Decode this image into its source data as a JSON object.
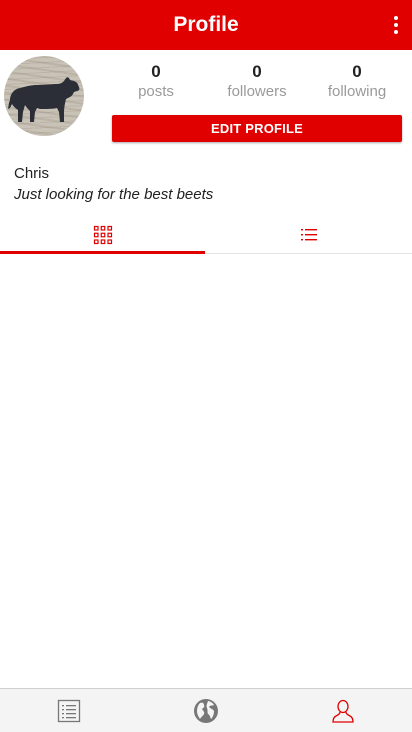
{
  "app_bar": {
    "title": "Profile",
    "color": "#e10000",
    "overflow_icon": "more-vert-icon"
  },
  "profile": {
    "avatar_icon": "cow-silhouette-avatar",
    "stats": [
      {
        "count": "0",
        "label": "posts"
      },
      {
        "count": "0",
        "label": "followers"
      },
      {
        "count": "0",
        "label": "following"
      }
    ],
    "edit_button_label": "EDIT PROFILE",
    "username": "Chris",
    "bio": "Just looking for the best beets"
  },
  "tabs": [
    {
      "icon": "grid-view-icon",
      "selected": true
    },
    {
      "icon": "list-view-icon",
      "selected": false
    }
  ],
  "bottom_nav": [
    {
      "icon": "feed-list-icon",
      "active": false
    },
    {
      "icon": "globe-icon",
      "active": false
    },
    {
      "icon": "person-icon",
      "active": true
    }
  ],
  "colors": {
    "accent": "#e10000",
    "muted_text": "#9a9a9a",
    "nav_inactive": "#777777"
  }
}
